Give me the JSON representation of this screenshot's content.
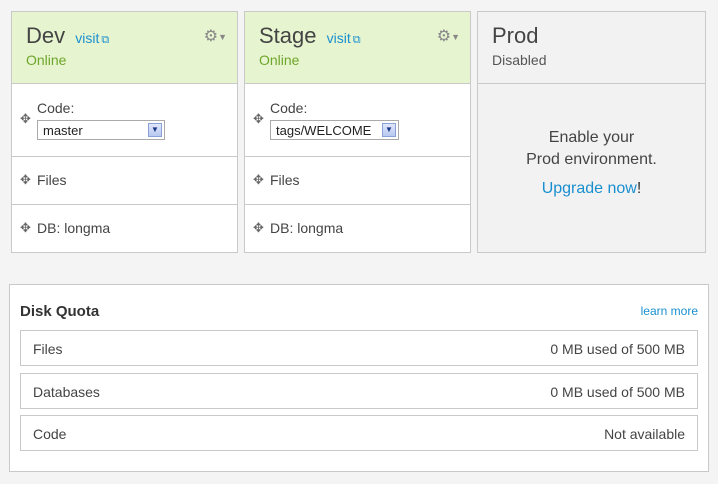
{
  "environments": {
    "dev": {
      "name": "Dev",
      "visit_label": "visit",
      "status": "Online",
      "code_label": "Code:",
      "code_value": "master",
      "files_label": "Files",
      "db_label": "DB: longma"
    },
    "stage": {
      "name": "Stage",
      "visit_label": "visit",
      "status": "Online",
      "code_label": "Code:",
      "code_value": "tags/WELCOME",
      "files_label": "Files",
      "db_label": "DB: longma"
    },
    "prod": {
      "name": "Prod",
      "status": "Disabled",
      "line1": "Enable your",
      "line2": "Prod environment.",
      "upgrade_label": "Upgrade now",
      "upgrade_suffix": "!"
    }
  },
  "quota": {
    "title": "Disk Quota",
    "learn_more": "learn more",
    "rows": [
      {
        "label": "Files",
        "value": "0 MB used of 500 MB"
      },
      {
        "label": "Databases",
        "value": "0 MB used of 500 MB"
      },
      {
        "label": "Code",
        "value": "Not available"
      }
    ]
  },
  "icons": {
    "gear": "gear-icon",
    "move": "move-icon",
    "external": "external-link-icon",
    "dropdown": "chevron-down-icon"
  },
  "colors": {
    "online": "#6fa52a",
    "link": "#1a8fd0",
    "header_bg": "#e6f5d0",
    "disabled_bg": "#f2f2f2"
  }
}
